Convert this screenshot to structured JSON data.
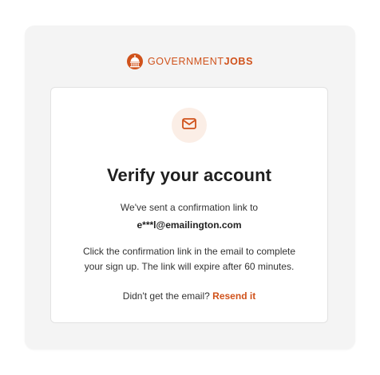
{
  "brand": {
    "name_light": "GOVERNMENT",
    "name_bold": "JOBS",
    "color": "#d0521b",
    "logo_icon": "capitol-dome-icon"
  },
  "card": {
    "icon": "mail-icon",
    "title": "Verify your account",
    "sent_text": "We've sent a confirmation link to",
    "email": "e***l@emailington.com",
    "instruction_line1": "Click the confirmation link in the email to complete",
    "instruction_line2": "your sign up. The link will expire after 60 minutes.",
    "resend_prompt": "Didn't get the email?",
    "resend_link": "Resend it"
  },
  "colors": {
    "accent": "#d0521b",
    "icon_circle_bg": "#fbeee6",
    "panel_bg": "#f4f4f4"
  }
}
